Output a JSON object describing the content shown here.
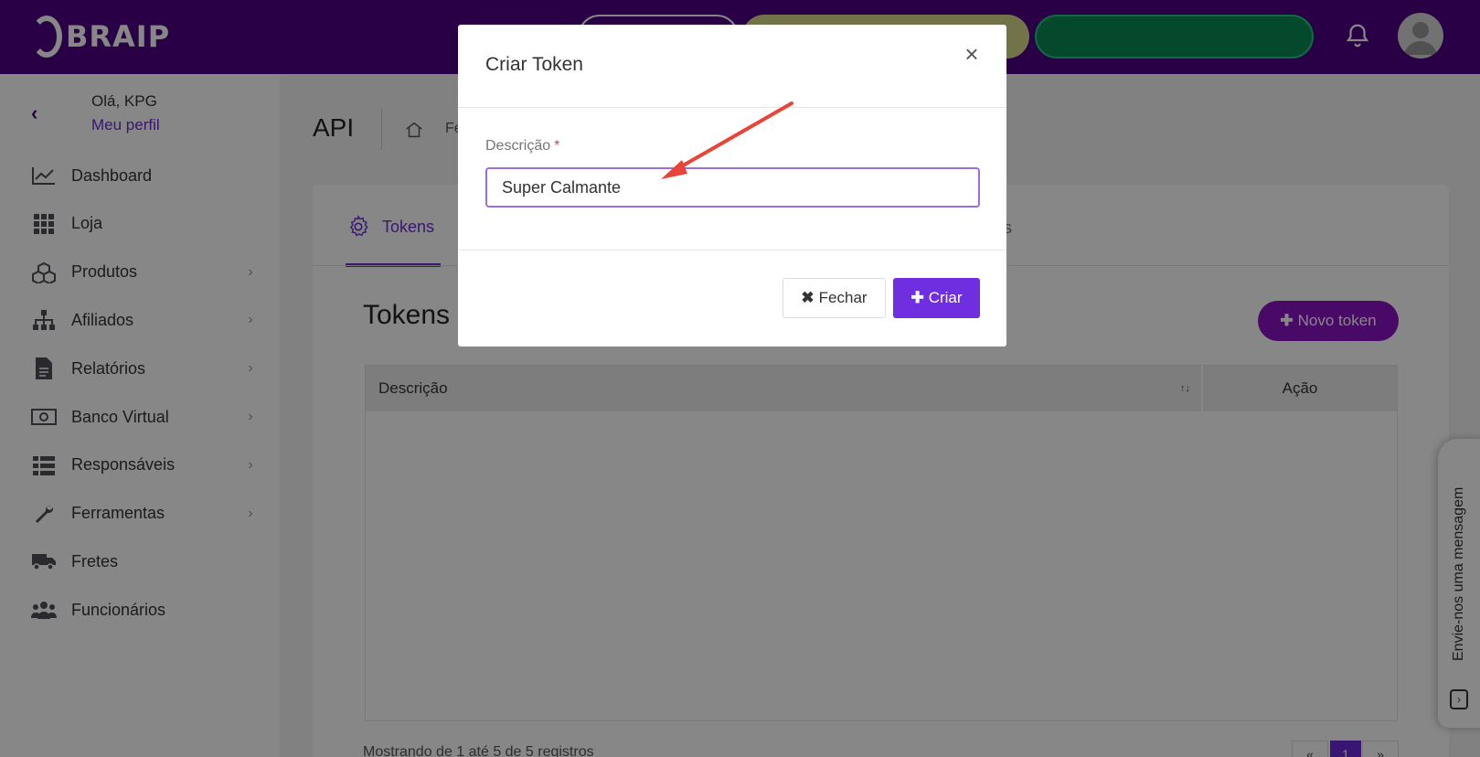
{
  "app": {
    "logo_text": "BRAIP",
    "colors": {
      "header": "#4e0082",
      "accent": "#6c2bd9",
      "pill_yellow": "#d9d98a",
      "pill_green": "#0b8a55",
      "danger": "#e23b5a"
    }
  },
  "header": {
    "icons": [
      "bell-icon",
      "user-avatar-icon"
    ]
  },
  "sidebar": {
    "greeting": "Olá, KPG",
    "profile_link": "Meu perfil",
    "items": [
      {
        "label": "Dashboard",
        "icon": "chart-line-icon",
        "submenu": false
      },
      {
        "label": "Loja",
        "icon": "grid-icon",
        "submenu": false
      },
      {
        "label": "Produtos",
        "icon": "boxes-icon",
        "submenu": true
      },
      {
        "label": "Afiliados",
        "icon": "sitemap-icon",
        "submenu": true
      },
      {
        "label": "Relatórios",
        "icon": "file-icon",
        "submenu": true
      },
      {
        "label": "Banco Virtual",
        "icon": "money-bill-icon",
        "submenu": true
      },
      {
        "label": "Responsáveis",
        "icon": "list-icon",
        "submenu": true
      },
      {
        "label": "Ferramentas",
        "icon": "wrench-icon",
        "submenu": true
      },
      {
        "label": "Fretes",
        "icon": "truck-icon",
        "submenu": false
      },
      {
        "label": "Funcionários",
        "icon": "users-icon",
        "submenu": false
      }
    ]
  },
  "main": {
    "page_title": "API",
    "breadcrumb_fragment": "Fe",
    "tabs": [
      {
        "label": "Tokens",
        "active": true
      }
    ],
    "tab_fragment": "s",
    "section_title": "Tokens",
    "new_token_button": "Novo token",
    "table": {
      "columns": [
        "Descrição",
        "Ação"
      ]
    },
    "footer_info": "Mostrando de 1 até 5 de 5 registros",
    "pager": {
      "first": "«",
      "current": "1",
      "last": "»"
    }
  },
  "chat": {
    "label": "Envie-nos uma mensagem"
  },
  "modal": {
    "title": "Criar Token",
    "close": "×",
    "field_label": "Descrição",
    "required_mark": "*",
    "field_value": "Super Calmante",
    "close_button": "Fechar",
    "create_button": "Criar"
  }
}
